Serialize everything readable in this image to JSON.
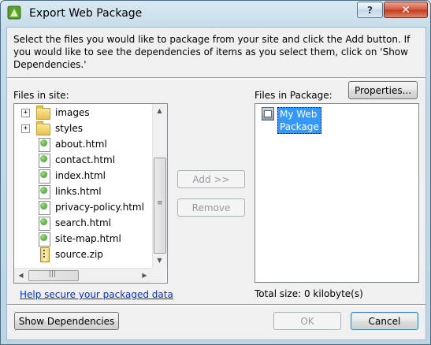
{
  "window": {
    "title": "Export Web Package",
    "help_glyph": "?",
    "close_glyph": "✕"
  },
  "instructions": "Select the files you would like to package from your site and click the Add button.  If you would like to see the dependencies of items as you select them, click on 'Show Dependencies.'",
  "site_panel": {
    "label": "Files in site:",
    "items": [
      {
        "name": "images",
        "type": "folder",
        "expandable": true
      },
      {
        "name": "styles",
        "type": "folder",
        "expandable": true
      },
      {
        "name": "about.html",
        "type": "html"
      },
      {
        "name": "contact.html",
        "type": "html"
      },
      {
        "name": "index.html",
        "type": "html"
      },
      {
        "name": "links.html",
        "type": "html"
      },
      {
        "name": "privacy-policy.html",
        "type": "html"
      },
      {
        "name": "search.html",
        "type": "html"
      },
      {
        "name": "site-map.html",
        "type": "html"
      },
      {
        "name": "source.zip",
        "type": "zip"
      }
    ],
    "expander_glyph": "+",
    "help_link": "Help secure your packaged data"
  },
  "middle": {
    "add_label": "Add >>",
    "remove_label": "Remove"
  },
  "package_panel": {
    "label": "Files in Package:",
    "properties_label": "Properties...",
    "package_name": "My Web Package",
    "total_size": "Total size: 0 kilobyte(s)"
  },
  "footer": {
    "show_dependencies_label": "Show Dependencies",
    "ok_label": "OK",
    "cancel_label": "Cancel"
  },
  "scroll": {
    "up": "▲",
    "down": "▼",
    "left": "◀",
    "right": "▶",
    "thumb_grip": "≡"
  }
}
